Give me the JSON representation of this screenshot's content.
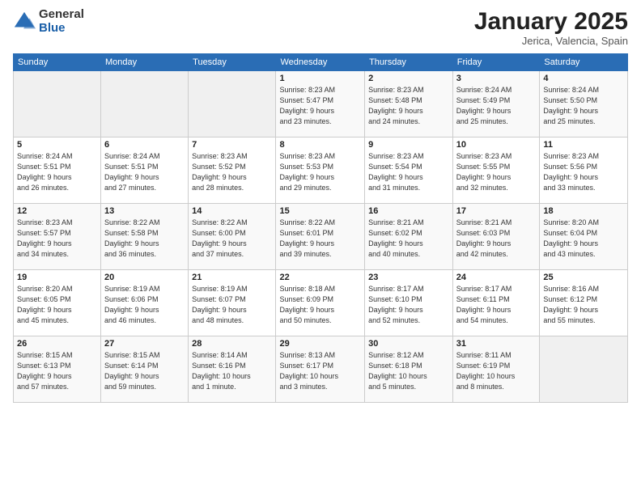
{
  "logo": {
    "general": "General",
    "blue": "Blue"
  },
  "title": "January 2025",
  "subtitle": "Jerica, Valencia, Spain",
  "headers": [
    "Sunday",
    "Monday",
    "Tuesday",
    "Wednesday",
    "Thursday",
    "Friday",
    "Saturday"
  ],
  "weeks": [
    [
      {
        "day": "",
        "info": ""
      },
      {
        "day": "",
        "info": ""
      },
      {
        "day": "",
        "info": ""
      },
      {
        "day": "1",
        "info": "Sunrise: 8:23 AM\nSunset: 5:47 PM\nDaylight: 9 hours\nand 23 minutes."
      },
      {
        "day": "2",
        "info": "Sunrise: 8:23 AM\nSunset: 5:48 PM\nDaylight: 9 hours\nand 24 minutes."
      },
      {
        "day": "3",
        "info": "Sunrise: 8:24 AM\nSunset: 5:49 PM\nDaylight: 9 hours\nand 25 minutes."
      },
      {
        "day": "4",
        "info": "Sunrise: 8:24 AM\nSunset: 5:50 PM\nDaylight: 9 hours\nand 25 minutes."
      }
    ],
    [
      {
        "day": "5",
        "info": "Sunrise: 8:24 AM\nSunset: 5:51 PM\nDaylight: 9 hours\nand 26 minutes."
      },
      {
        "day": "6",
        "info": "Sunrise: 8:24 AM\nSunset: 5:51 PM\nDaylight: 9 hours\nand 27 minutes."
      },
      {
        "day": "7",
        "info": "Sunrise: 8:23 AM\nSunset: 5:52 PM\nDaylight: 9 hours\nand 28 minutes."
      },
      {
        "day": "8",
        "info": "Sunrise: 8:23 AM\nSunset: 5:53 PM\nDaylight: 9 hours\nand 29 minutes."
      },
      {
        "day": "9",
        "info": "Sunrise: 8:23 AM\nSunset: 5:54 PM\nDaylight: 9 hours\nand 31 minutes."
      },
      {
        "day": "10",
        "info": "Sunrise: 8:23 AM\nSunset: 5:55 PM\nDaylight: 9 hours\nand 32 minutes."
      },
      {
        "day": "11",
        "info": "Sunrise: 8:23 AM\nSunset: 5:56 PM\nDaylight: 9 hours\nand 33 minutes."
      }
    ],
    [
      {
        "day": "12",
        "info": "Sunrise: 8:23 AM\nSunset: 5:57 PM\nDaylight: 9 hours\nand 34 minutes."
      },
      {
        "day": "13",
        "info": "Sunrise: 8:22 AM\nSunset: 5:58 PM\nDaylight: 9 hours\nand 36 minutes."
      },
      {
        "day": "14",
        "info": "Sunrise: 8:22 AM\nSunset: 6:00 PM\nDaylight: 9 hours\nand 37 minutes."
      },
      {
        "day": "15",
        "info": "Sunrise: 8:22 AM\nSunset: 6:01 PM\nDaylight: 9 hours\nand 39 minutes."
      },
      {
        "day": "16",
        "info": "Sunrise: 8:21 AM\nSunset: 6:02 PM\nDaylight: 9 hours\nand 40 minutes."
      },
      {
        "day": "17",
        "info": "Sunrise: 8:21 AM\nSunset: 6:03 PM\nDaylight: 9 hours\nand 42 minutes."
      },
      {
        "day": "18",
        "info": "Sunrise: 8:20 AM\nSunset: 6:04 PM\nDaylight: 9 hours\nand 43 minutes."
      }
    ],
    [
      {
        "day": "19",
        "info": "Sunrise: 8:20 AM\nSunset: 6:05 PM\nDaylight: 9 hours\nand 45 minutes."
      },
      {
        "day": "20",
        "info": "Sunrise: 8:19 AM\nSunset: 6:06 PM\nDaylight: 9 hours\nand 46 minutes."
      },
      {
        "day": "21",
        "info": "Sunrise: 8:19 AM\nSunset: 6:07 PM\nDaylight: 9 hours\nand 48 minutes."
      },
      {
        "day": "22",
        "info": "Sunrise: 8:18 AM\nSunset: 6:09 PM\nDaylight: 9 hours\nand 50 minutes."
      },
      {
        "day": "23",
        "info": "Sunrise: 8:17 AM\nSunset: 6:10 PM\nDaylight: 9 hours\nand 52 minutes."
      },
      {
        "day": "24",
        "info": "Sunrise: 8:17 AM\nSunset: 6:11 PM\nDaylight: 9 hours\nand 54 minutes."
      },
      {
        "day": "25",
        "info": "Sunrise: 8:16 AM\nSunset: 6:12 PM\nDaylight: 9 hours\nand 55 minutes."
      }
    ],
    [
      {
        "day": "26",
        "info": "Sunrise: 8:15 AM\nSunset: 6:13 PM\nDaylight: 9 hours\nand 57 minutes."
      },
      {
        "day": "27",
        "info": "Sunrise: 8:15 AM\nSunset: 6:14 PM\nDaylight: 9 hours\nand 59 minutes."
      },
      {
        "day": "28",
        "info": "Sunrise: 8:14 AM\nSunset: 6:16 PM\nDaylight: 10 hours\nand 1 minute."
      },
      {
        "day": "29",
        "info": "Sunrise: 8:13 AM\nSunset: 6:17 PM\nDaylight: 10 hours\nand 3 minutes."
      },
      {
        "day": "30",
        "info": "Sunrise: 8:12 AM\nSunset: 6:18 PM\nDaylight: 10 hours\nand 5 minutes."
      },
      {
        "day": "31",
        "info": "Sunrise: 8:11 AM\nSunset: 6:19 PM\nDaylight: 10 hours\nand 8 minutes."
      },
      {
        "day": "",
        "info": ""
      }
    ]
  ]
}
